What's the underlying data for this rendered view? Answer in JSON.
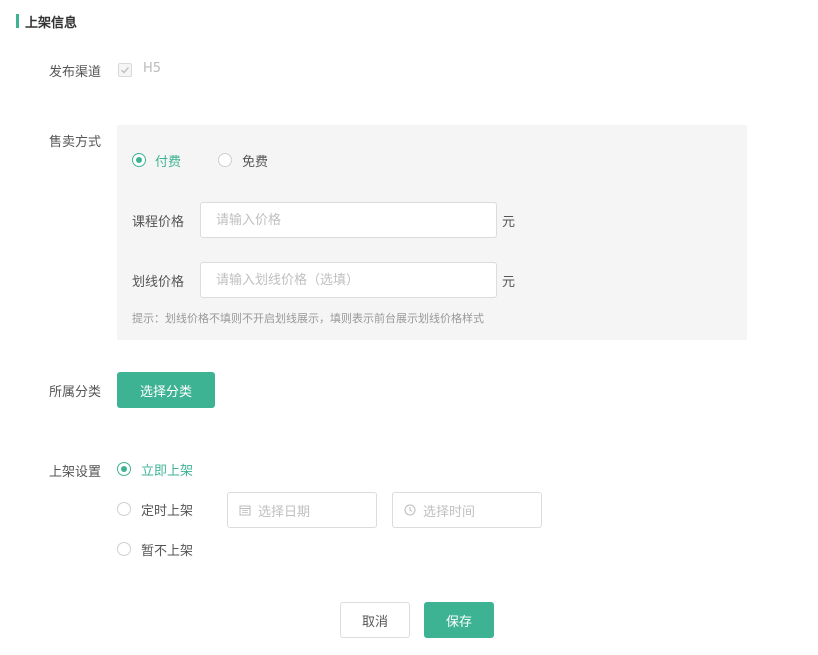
{
  "section": {
    "title": "上架信息"
  },
  "channel": {
    "label": "发布渠道",
    "option": "H5",
    "checked": true
  },
  "sale": {
    "label": "售卖方式",
    "options": [
      {
        "label": "付费",
        "checked": true
      },
      {
        "label": "免费",
        "checked": false
      }
    ],
    "price": {
      "label": "课程价格",
      "placeholder": "请输入价格",
      "unit": "元"
    },
    "strike_price": {
      "label": "划线价格",
      "placeholder": "请输入划线价格（选填）",
      "unit": "元"
    },
    "hint": "提示：划线价格不填则不开启划线展示，填则表示前台展示划线价格样式"
  },
  "category": {
    "label": "所属分类",
    "button": "选择分类"
  },
  "listing": {
    "label": "上架设置",
    "options": [
      {
        "label": "立即上架",
        "checked": true
      },
      {
        "label": "定时上架",
        "checked": false
      },
      {
        "label": "暂不上架",
        "checked": false
      }
    ],
    "date_placeholder": "选择日期",
    "time_placeholder": "选择时间"
  },
  "footer": {
    "cancel": "取消",
    "save": "保存"
  },
  "colors": {
    "accent": "#3eb394",
    "panel_bg": "#f5f5f5",
    "border": "#dcdcdc"
  },
  "icons": {
    "checkbox": "check-icon",
    "date": "calendar-icon",
    "time": "clock-icon"
  }
}
